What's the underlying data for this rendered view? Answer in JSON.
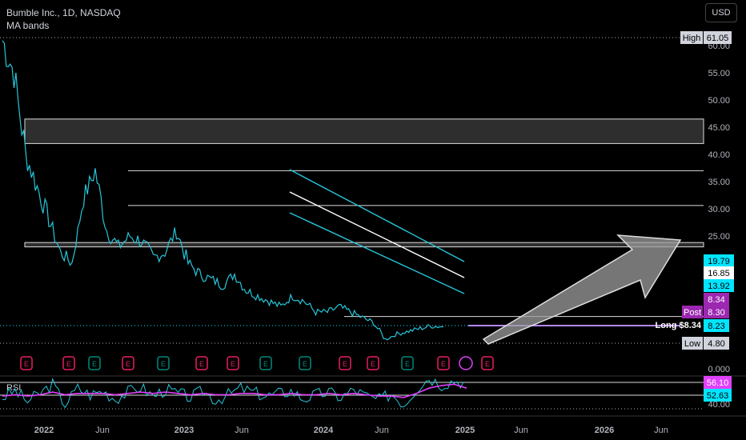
{
  "header": {
    "symbol": "Bumble Inc., 1D, NASDAQ",
    "indicator": "MA bands"
  },
  "currency_button": "USD",
  "rsi_title": "RSI",
  "colors": {
    "price": "#26c6da",
    "ma_mid": "#ffffff",
    "rsi": "#26c6da",
    "rsi_ma": "#e040fb",
    "long_line": "#b388ff",
    "arrow": "#9e9e9e",
    "earnings": "#e91e63",
    "earnings_alt": "#00897b",
    "tag_cyan": "#00e5ff",
    "tag_purple": "#9c27b0"
  },
  "chart_data": [
    {
      "type": "line",
      "title": "",
      "y_ticks": [
        "60.00",
        "55.00",
        "50.00",
        "45.00",
        "40.00",
        "35.00",
        "30.00",
        "25.00",
        "0.000"
      ],
      "x_ticks": [
        "2022",
        "Jun",
        "2023",
        "Jun",
        "2024",
        "Jun",
        "2025",
        "Jun",
        "2026",
        "Jun"
      ],
      "series": [
        {
          "name": "Bumble Inc.",
          "x": [
            "2021-11",
            "2021-12",
            "2022-01",
            "2022-02",
            "2022-03",
            "2022-04",
            "2022-05",
            "2022-06",
            "2022-07",
            "2022-08",
            "2022-09",
            "2022-10",
            "2022-11",
            "2022-12",
            "2023-01",
            "2023-02",
            "2023-03",
            "2023-04",
            "2023-05",
            "2023-06",
            "2023-07",
            "2023-08",
            "2023-09",
            "2023-10",
            "2023-11",
            "2023-12",
            "2024-01",
            "2024-02",
            "2024-03",
            "2024-04",
            "2024-05",
            "2024-06",
            "2024-07",
            "2024-08",
            "2024-09",
            "2024-10",
            "2024-11",
            "2024-12",
            "2025-01"
          ],
          "values": [
            61,
            55,
            40,
            34,
            28,
            22,
            20,
            32,
            37,
            26,
            23,
            25,
            24,
            21,
            22,
            26,
            20,
            18,
            17,
            16,
            18,
            15,
            14,
            13,
            12,
            14,
            13,
            11,
            11,
            12,
            11,
            10,
            9,
            6,
            7,
            7.5,
            8,
            8.5,
            8.3
          ]
        }
      ],
      "ma_bands": {
        "upper_start": 36.5,
        "upper_end": 19.79,
        "mid_start": 33,
        "mid_end": 16.85,
        "lower_start": 29.5,
        "lower_end": 13.92
      },
      "levels": [
        {
          "label": "High",
          "value": "61.05"
        },
        {
          "label": "Low",
          "value": "4.80"
        },
        {
          "label": "Post",
          "value": "8.30"
        },
        {
          "label": "",
          "value": "19.79"
        },
        {
          "label": "",
          "value": "16.85"
        },
        {
          "label": "",
          "value": "13.92"
        },
        {
          "label": "",
          "value": "8.34"
        },
        {
          "label": "",
          "value": "8.23"
        }
      ],
      "zones": [
        [
          42,
          46.5
        ],
        [
          23,
          23.8
        ]
      ],
      "horizontal_lines": [
        37,
        30.6,
        10.2
      ],
      "long_label": "Long $8.34",
      "earnings_markers": [
        "E",
        "E",
        "E",
        "E",
        "E",
        "E",
        "E",
        "E",
        "E",
        "E",
        "E",
        "E",
        "E",
        "E"
      ]
    },
    {
      "type": "line",
      "title": "RSI",
      "y_ticks": [
        "40.00"
      ],
      "levels": [
        {
          "label": "",
          "value": "56.10"
        },
        {
          "label": "",
          "value": "52.63"
        }
      ],
      "series": [
        {
          "name": "RSI",
          "values": [
            45,
            50,
            42,
            48,
            55,
            40,
            52,
            47,
            50,
            44,
            49,
            53,
            46,
            51,
            48,
            45,
            50,
            43,
            47,
            52,
            49,
            46,
            48,
            50,
            44,
            47,
            49,
            45,
            51,
            46,
            43,
            48,
            40,
            52,
            60,
            55,
            58,
            56
          ]
        },
        {
          "name": "RSI MA",
          "values": [
            46,
            47,
            46,
            47,
            49,
            47,
            48,
            48,
            48,
            47,
            48,
            49,
            48,
            49,
            48,
            47,
            48,
            47,
            47,
            48,
            48,
            47,
            47,
            48,
            47,
            47,
            48,
            47,
            48,
            47,
            46,
            46,
            45,
            48,
            52,
            54,
            55,
            52
          ]
        }
      ]
    }
  ]
}
